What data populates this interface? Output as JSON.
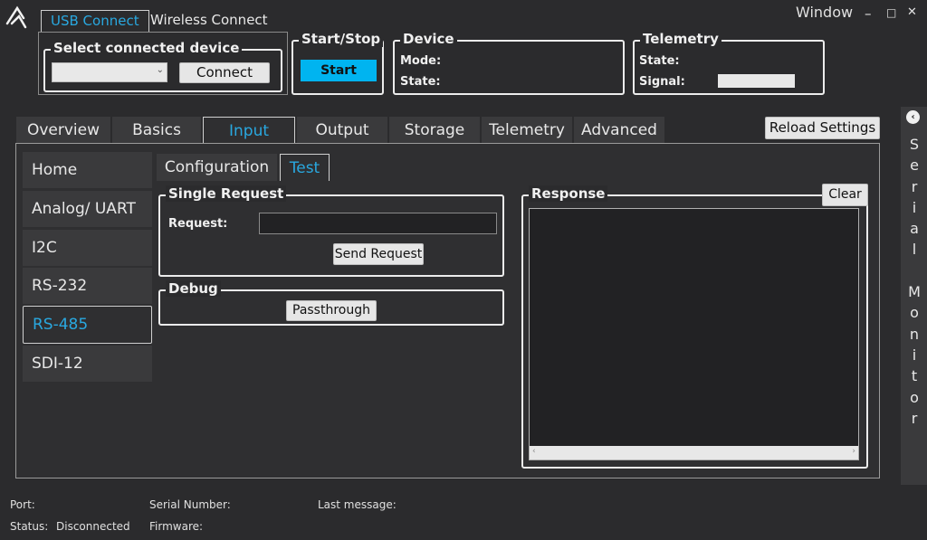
{
  "app": {
    "window_label": "Window"
  },
  "connection_tabs": {
    "usb": "USB Connect",
    "wireless": "Wireless Connect"
  },
  "select_device": {
    "title": "Select connected device",
    "selected_value": "",
    "connect_label": "Connect"
  },
  "start_stop": {
    "title": "Start/Stop",
    "start_label": "Start"
  },
  "device": {
    "title": "Device",
    "mode_label": "Mode:",
    "state_label": "State:"
  },
  "telemetry_box": {
    "title": "Telemetry",
    "state_label": "State:",
    "signal_label": "Signal:"
  },
  "main_tabs": [
    "Overview",
    "Basics",
    "Input",
    "Output",
    "Storage",
    "Telemetry",
    "Advanced"
  ],
  "reload_label": "Reload Settings",
  "sidebar": [
    "Home",
    "Analog/ UART",
    "I2C",
    "RS-232",
    "RS-485",
    "SDI-12"
  ],
  "sub_tabs": {
    "configuration": "Configuration",
    "test": "Test"
  },
  "single_request": {
    "title": "Single Request",
    "request_label": "Request:",
    "request_value": "",
    "send_label": "Send Request"
  },
  "debug": {
    "title": "Debug",
    "passthrough_label": "Passthrough"
  },
  "response": {
    "title": "Response",
    "clear_label": "Clear"
  },
  "serial_monitor": {
    "letters": [
      "S",
      "e",
      "r",
      "i",
      "a",
      "l",
      "",
      "M",
      "o",
      "n",
      "i",
      "t",
      "o",
      "r"
    ]
  },
  "status_bar": {
    "port_label": "Port:",
    "status_label": "Status:",
    "status_value": "Disconnected",
    "serial_label": "Serial Number:",
    "firmware_label": "Firmware:",
    "last_message_label": "Last message:"
  },
  "colors": {
    "accent": "#29a8e0",
    "start_button": "#00b4f0",
    "background": "#2b2b2d"
  }
}
